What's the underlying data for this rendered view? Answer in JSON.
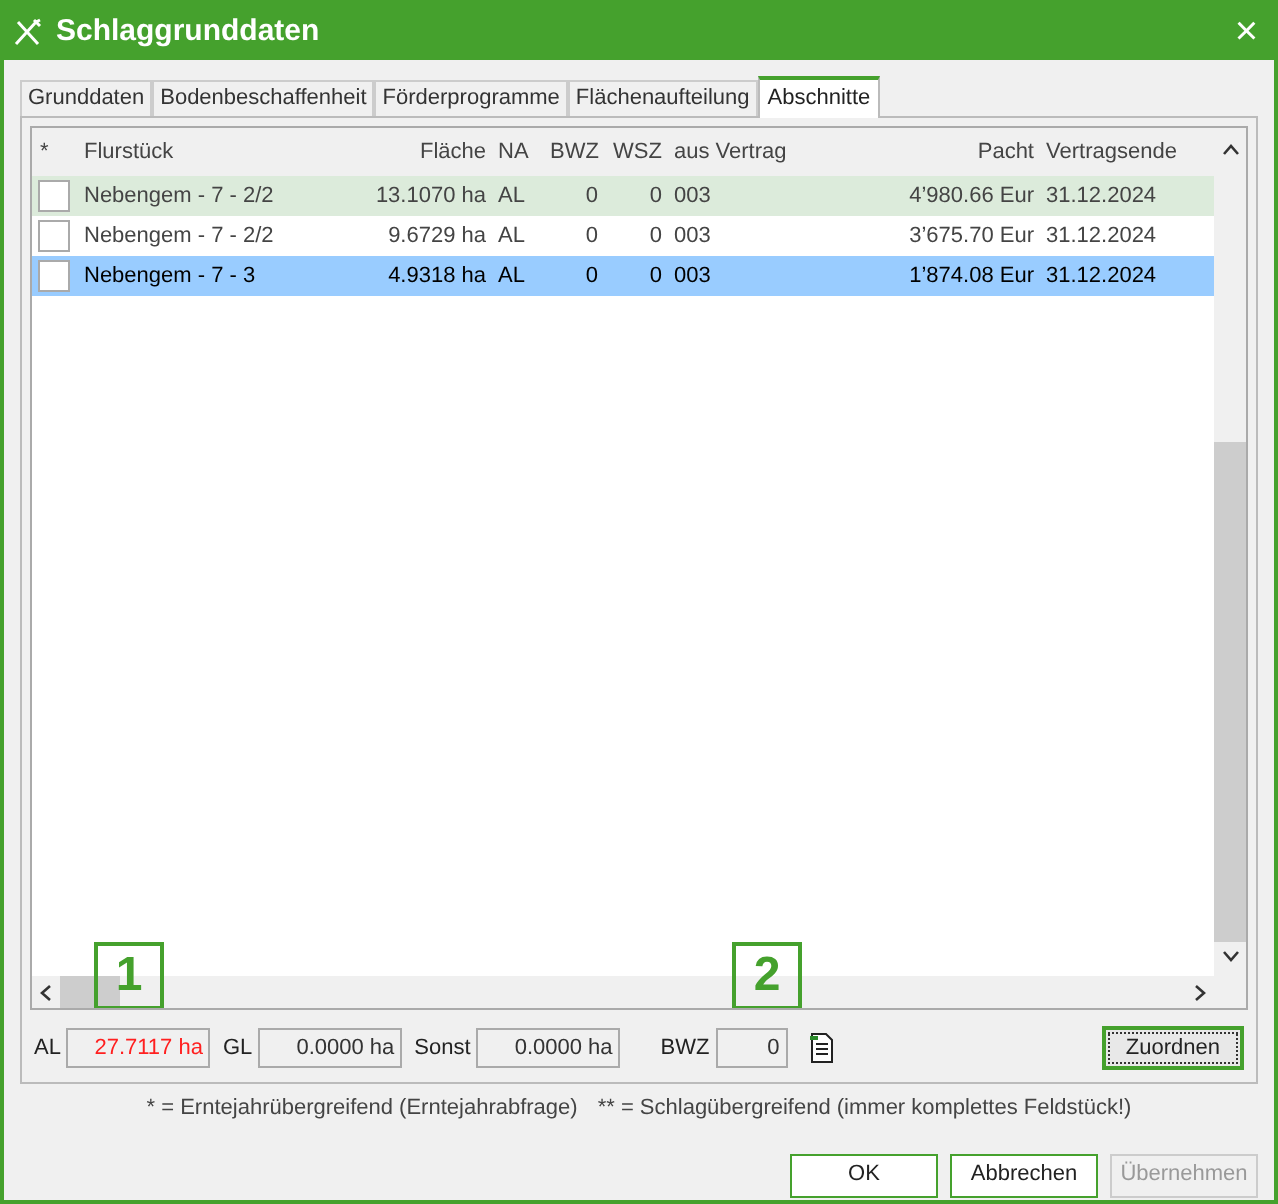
{
  "window": {
    "title": "Schlaggrunddaten",
    "close": "×"
  },
  "tabs": [
    {
      "label": "Grunddaten",
      "selected": false
    },
    {
      "label": "Bodenbeschaffenheit",
      "selected": false
    },
    {
      "label": "Förderprogramme",
      "selected": false
    },
    {
      "label": "Flächenaufteilung",
      "selected": false
    },
    {
      "label": "Abschnitte",
      "selected": true
    }
  ],
  "table": {
    "check_column_header": "*",
    "columns": [
      "Flurstück",
      "Fläche",
      "NA",
      "BWZ",
      "WSZ",
      "aus Vertrag",
      "Pacht",
      "Vertragsende"
    ],
    "rows": [
      {
        "checked": false,
        "selected": false,
        "highlighted": true,
        "cells": [
          "Nebengem - 7 - 2/2",
          "13.1070 ha",
          "AL",
          "0",
          "0",
          "003",
          "4’980.66 Eur",
          "31.12.2024"
        ]
      },
      {
        "checked": false,
        "selected": false,
        "highlighted": false,
        "cells": [
          "Nebengem - 7 - 2/2",
          "9.6729 ha",
          "AL",
          "0",
          "0",
          "003",
          "3’675.70 Eur",
          "31.12.2024"
        ]
      },
      {
        "checked": false,
        "selected": true,
        "highlighted": false,
        "cells": [
          "Nebengem - 7 - 3",
          "4.9318 ha",
          "AL",
          "0",
          "0",
          "003",
          "1’874.08 Eur",
          "31.12.2024"
        ]
      }
    ]
  },
  "callouts": [
    "1",
    "2"
  ],
  "totals": [
    {
      "label": "AL",
      "value": "27.7117 ha",
      "warning": true
    },
    {
      "label": "GL",
      "value": "0.0000 ha",
      "warning": false
    },
    {
      "label": "Sonst",
      "value": "0.0000 ha",
      "warning": false
    },
    {
      "label": "BWZ",
      "value": "0",
      "warning": false
    }
  ],
  "assign_button": "Zuordnen",
  "legend": [
    "* = Erntejahrübergreifend (Erntejahrabfrage)",
    "** = Schlagübergreifend (immer komplettes Feldstück!)"
  ],
  "buttons": [
    {
      "label": "OK",
      "disabled": false
    },
    {
      "label": "Abbrechen",
      "disabled": false
    },
    {
      "label": "Übernehmen",
      "disabled": true
    }
  ]
}
